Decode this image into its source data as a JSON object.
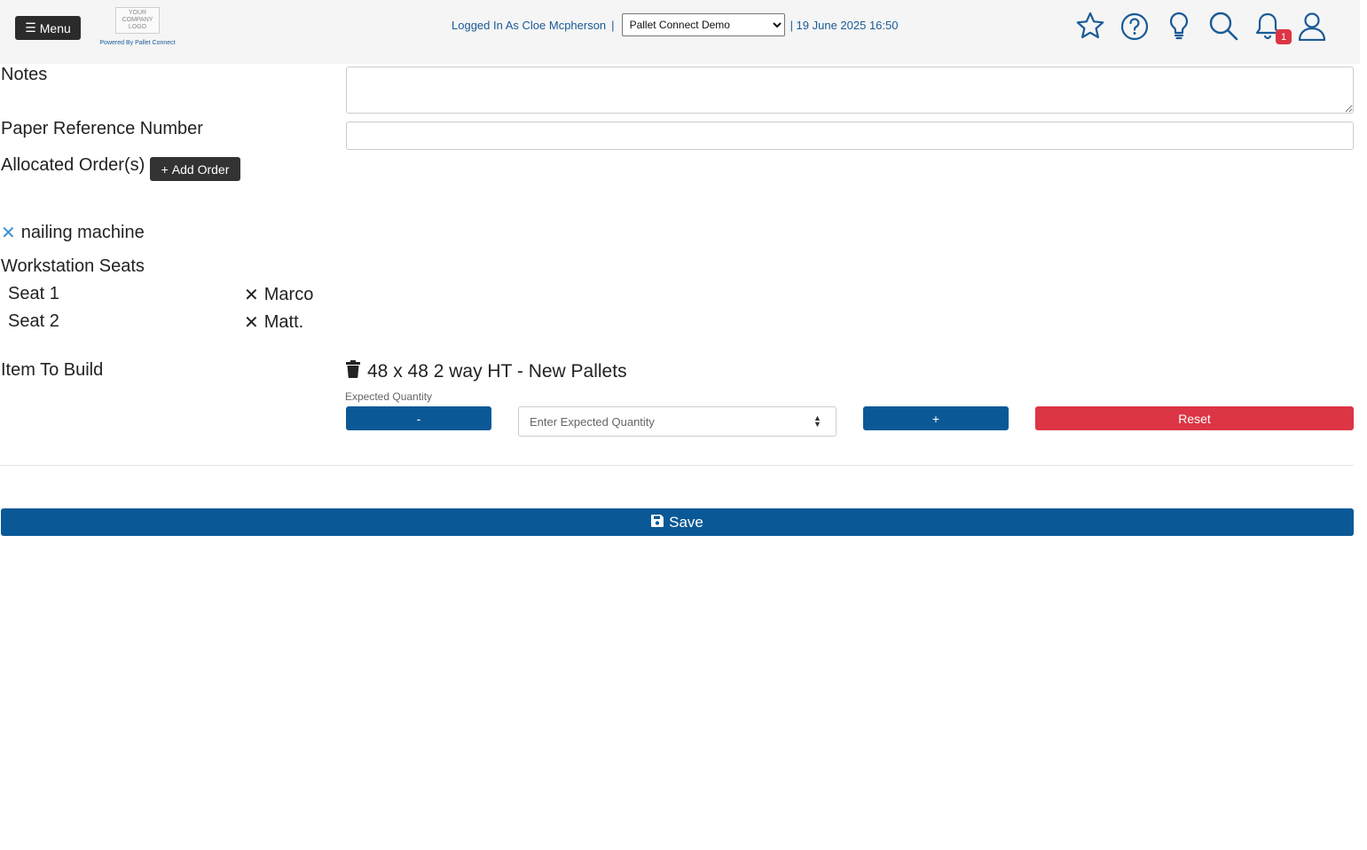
{
  "header": {
    "menu_label": "Menu",
    "logo_text": "YOUR COMPANY LOGO",
    "powered_by": "Powered By Pallet Connect",
    "logged_in": "Logged In As Cloe Mcpherson",
    "separator": "|",
    "company_selected": "Pallet Connect Demo",
    "datetime": "| 19 June 2025 16:50",
    "icons": [
      "star-icon",
      "help-icon",
      "lightbulb-icon",
      "search-icon",
      "bell-icon",
      "user-icon"
    ],
    "notification_count": "1"
  },
  "form": {
    "notes_label": "Notes",
    "notes_value": "",
    "paper_ref_label": "Paper Reference Number",
    "paper_ref_value": "",
    "allocated_orders_label": "Allocated Order(s)",
    "add_order_label": "Add Order",
    "machine_name": "nailing machine",
    "workstation_seats_label": "Workstation Seats",
    "seats": [
      {
        "seat": "Seat 1",
        "person": "Marco"
      },
      {
        "seat": "Seat 2",
        "person": "Matt."
      }
    ],
    "item_to_build_label": "Item To Build",
    "item_name": "48 x 48 2 way HT - New Pallets",
    "expected_quantity_label": "Expected Quantity",
    "expected_quantity_placeholder": "Enter Expected Quantity",
    "minus_label": "-",
    "plus_label": "+",
    "reset_label": "Reset",
    "save_label": "Save"
  },
  "colors": {
    "primary_blue": "#0a5996",
    "danger_red": "#dc3545",
    "dark_button": "#333333",
    "link_blue": "#1a5a96"
  }
}
